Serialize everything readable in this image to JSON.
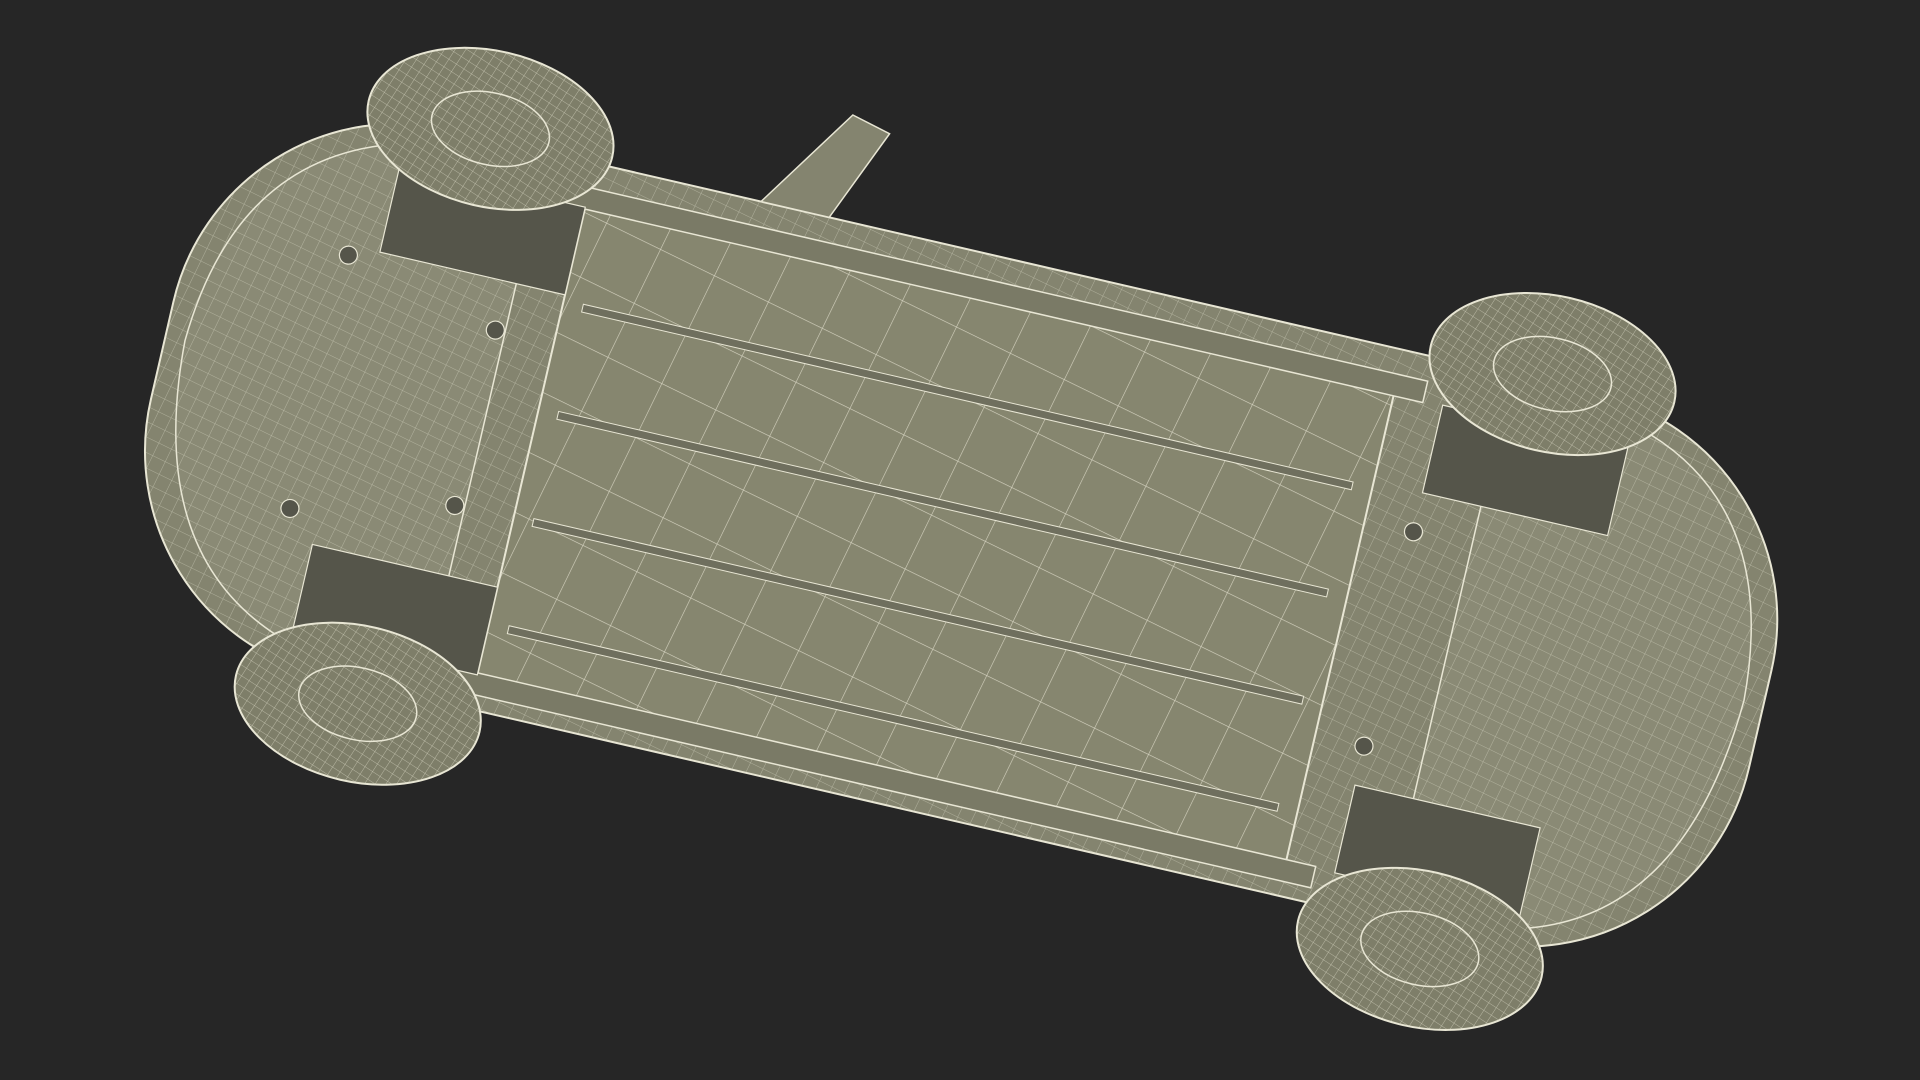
{
  "scene": {
    "subject": "car-underbody-wireframe",
    "colors": {
      "background": "#262626",
      "body_fill": "#84846f",
      "panel_fill": "#8a8a75",
      "shade_fill": "#6f6f5e",
      "dark_fill": "#55554a",
      "wire": "#e8e6d4"
    }
  }
}
